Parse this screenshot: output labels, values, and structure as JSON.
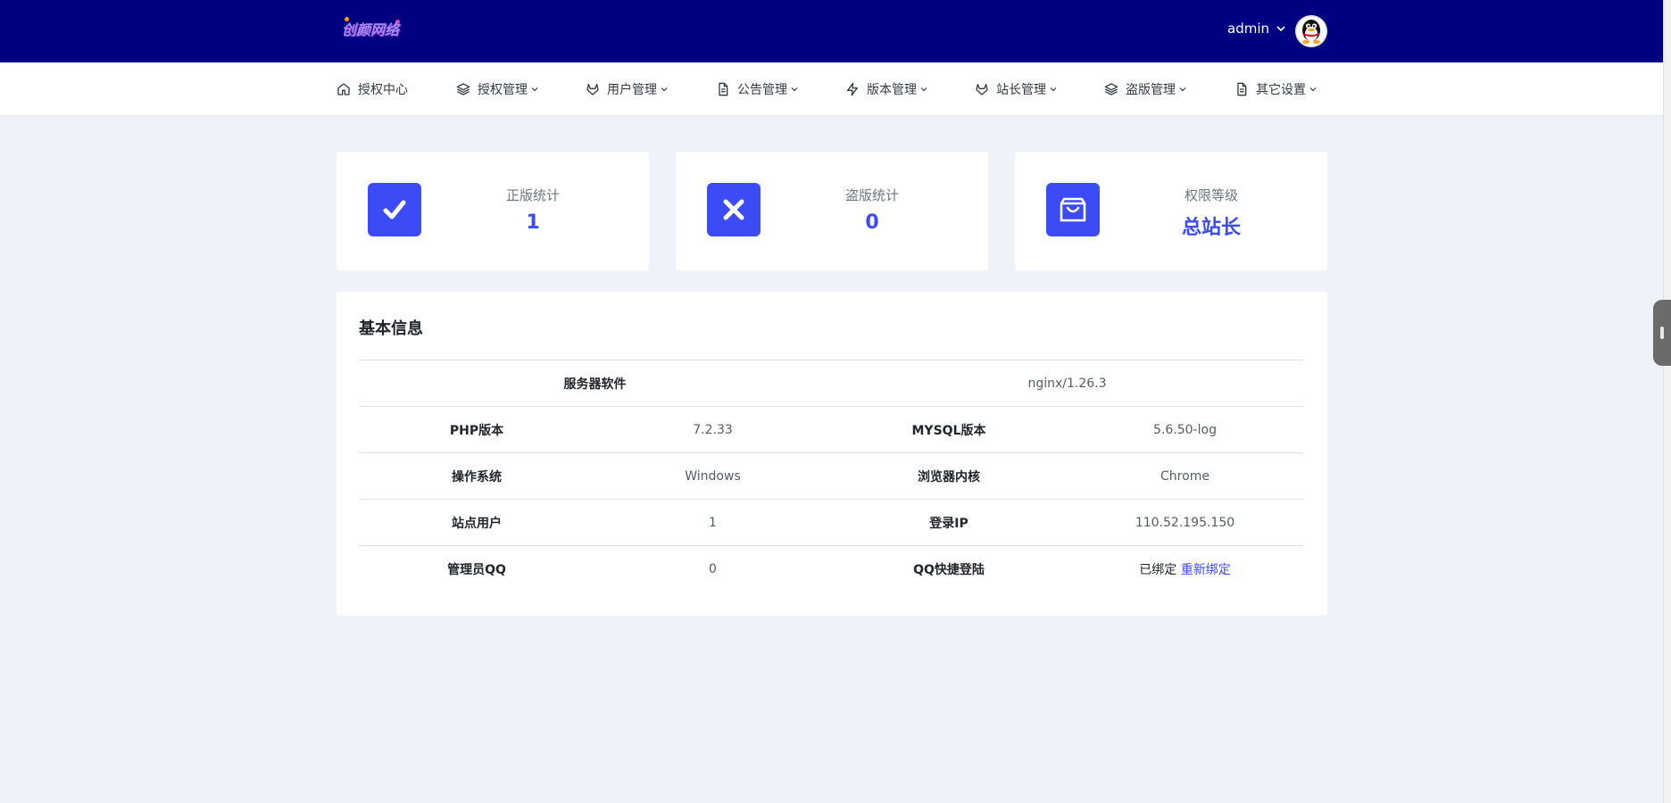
{
  "header": {
    "logo_text": "创颜网络",
    "user_name": "admin"
  },
  "nav": {
    "items": [
      {
        "label": "授权中心",
        "icon": "home-icon",
        "has_dropdown": false
      },
      {
        "label": "授权管理",
        "icon": "layers-icon",
        "has_dropdown": true
      },
      {
        "label": "用户管理",
        "icon": "gitlab-icon",
        "has_dropdown": true
      },
      {
        "label": "公告管理",
        "icon": "file-text-icon",
        "has_dropdown": true
      },
      {
        "label": "版本管理",
        "icon": "zap-icon",
        "has_dropdown": true
      },
      {
        "label": "站长管理",
        "icon": "gitlab-icon",
        "has_dropdown": true
      },
      {
        "label": "盗版管理",
        "icon": "layers-icon",
        "has_dropdown": true
      },
      {
        "label": "其它设置",
        "icon": "file-text-icon",
        "has_dropdown": true
      }
    ]
  },
  "stats": [
    {
      "label": "正版统计",
      "value": "1",
      "icon": "check-icon"
    },
    {
      "label": "盗版统计",
      "value": "0",
      "icon": "x-icon"
    },
    {
      "label": "权限等级",
      "value": "总站长",
      "icon": "shopping-bag-icon"
    }
  ],
  "info": {
    "title": "基本信息",
    "server_software": {
      "key": "服务器软件",
      "value": "nginx/1.26.3"
    },
    "rows": [
      {
        "k1": "PHP版本",
        "v1": "7.2.33",
        "k2": "MYSQL版本",
        "v2": "5.6.50-log"
      },
      {
        "k1": "操作系统",
        "v1": "Windows",
        "k2": "浏览器内核",
        "v2": "Chrome"
      },
      {
        "k1": "站点用户",
        "v1": "1",
        "k2": "登录IP",
        "v2": "110.52.195.150"
      },
      {
        "k1": "管理员QQ",
        "v1": "0",
        "k2": "QQ快捷登陆",
        "v2": "已绑定",
        "v2_link": "重新绑定"
      }
    ]
  },
  "colors": {
    "topbar": "#000080",
    "accent": "#3b4bf6",
    "background": "#eff2f9"
  }
}
